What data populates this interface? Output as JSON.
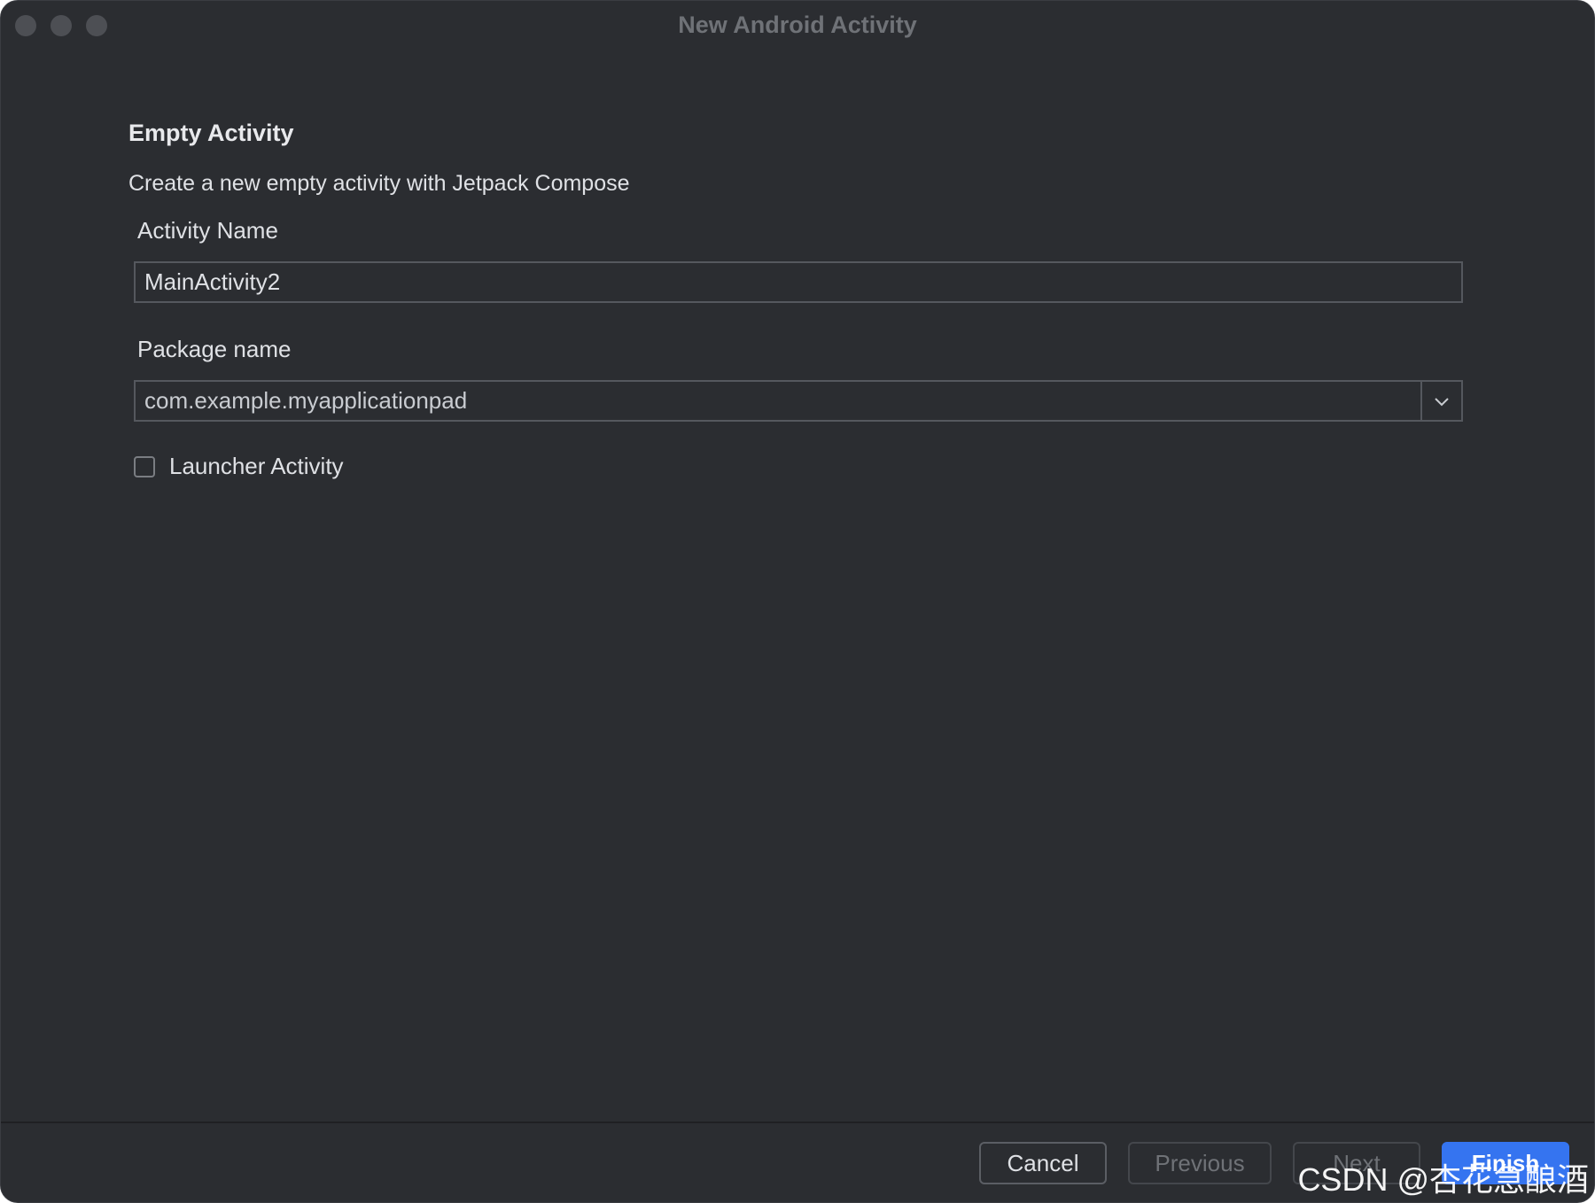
{
  "window": {
    "title": "New Android Activity"
  },
  "content": {
    "heading": "Empty Activity",
    "description": "Create a new empty activity with Jetpack Compose",
    "activity_name": {
      "label": "Activity Name",
      "value": "MainActivity2"
    },
    "package_name": {
      "label": "Package name",
      "value": "com.example.myapplicationpad"
    },
    "launcher_activity": {
      "label": "Launcher Activity",
      "checked": false
    }
  },
  "footer": {
    "cancel_label": "Cancel",
    "previous_label": "Previous",
    "next_label": "Next",
    "finish_label": "Finish"
  },
  "watermark": "CSDN @杏花急酿酒",
  "colors": {
    "background": "#2b2d31",
    "accent": "#3574f0"
  },
  "icons": {
    "dropdown": "chevron-down-icon"
  }
}
